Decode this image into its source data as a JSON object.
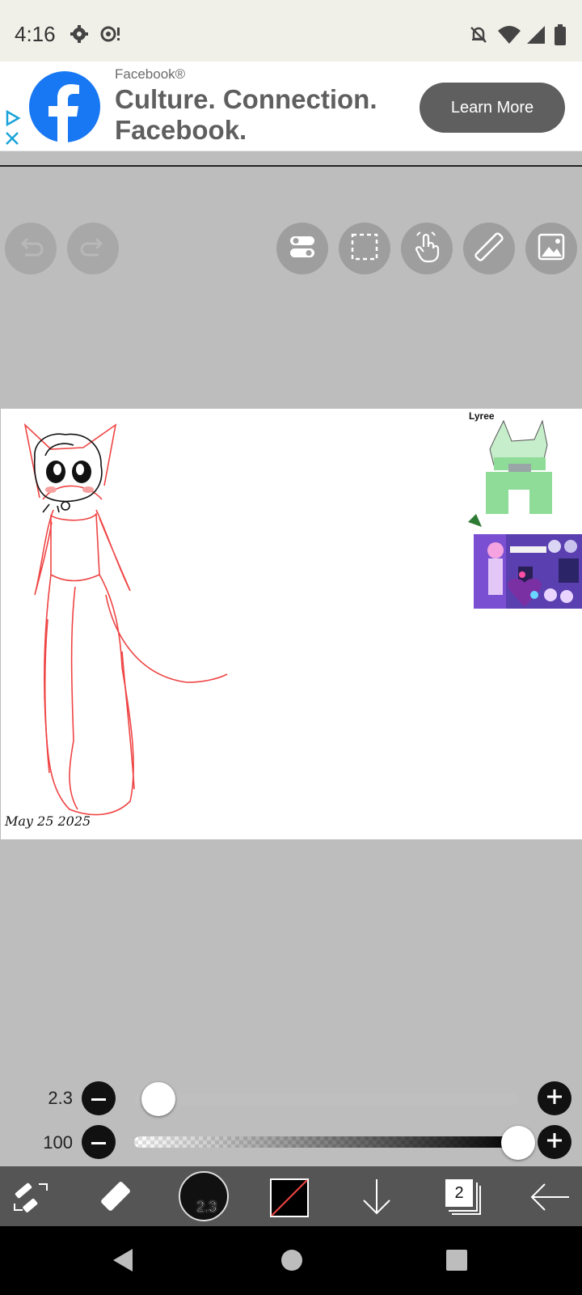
{
  "status_bar": {
    "time": "4:16"
  },
  "ad": {
    "sponsor": "Facebook®",
    "headline": "Culture. Connection. Facebook.",
    "cta_label": "Learn More"
  },
  "canvas": {
    "label_top_right": "Lyree",
    "signature": "May 25 2025"
  },
  "brush_size": {
    "value": "2.3",
    "fraction": 0.02
  },
  "opacity": {
    "value": "100",
    "fraction": 1.0
  },
  "bottom_toolbar": {
    "brush_badge": "2.3",
    "layer_count": "2"
  },
  "colors": {
    "accent_facebook": "#1877f2",
    "toolbar_button": "#9e9e9e",
    "canvas_bg": "#ffffff",
    "workspace_bg": "#bdbdbd",
    "sketch_red": "#ef4444"
  }
}
